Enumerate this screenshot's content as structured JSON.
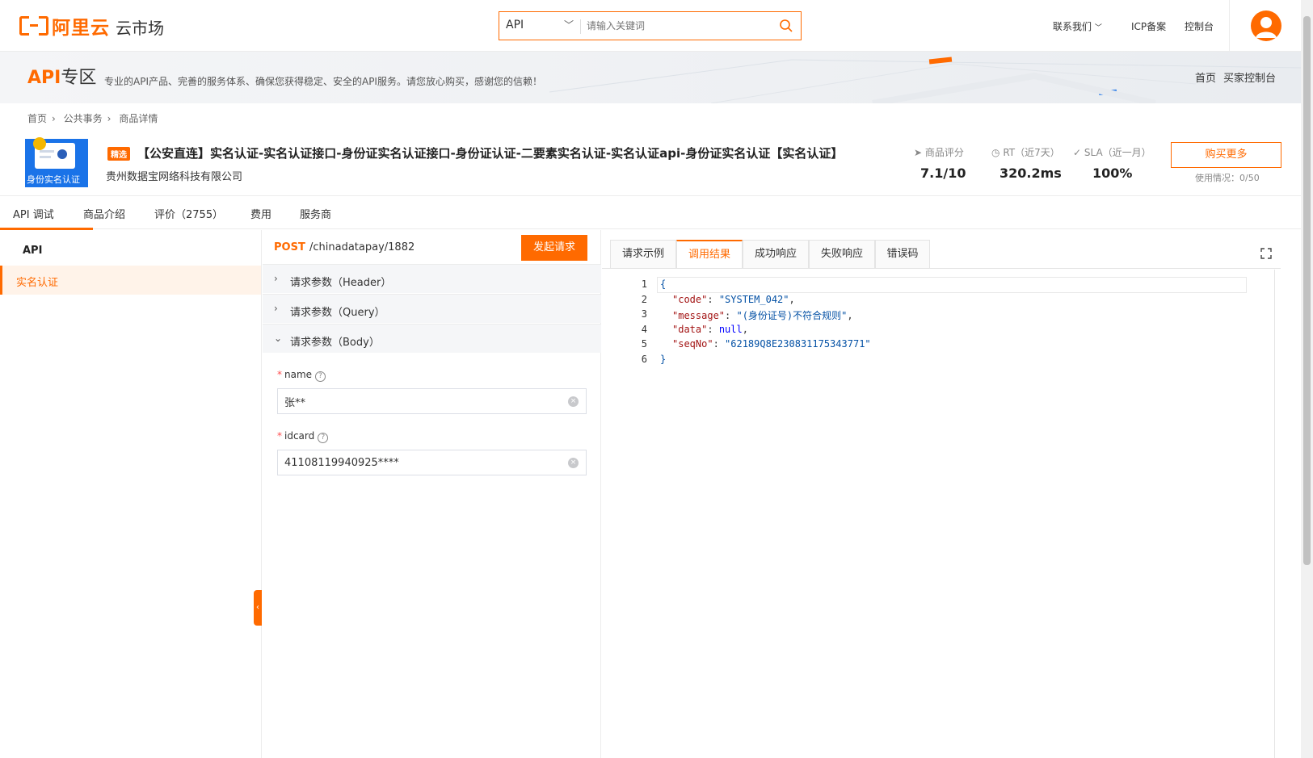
{
  "header": {
    "logo_text": "阿里云",
    "logo_sub": "云市场",
    "search_type": "API",
    "search_placeholder": "请输入关键词",
    "links": [
      "联系我们",
      "ICP备案",
      "控制台"
    ]
  },
  "banner": {
    "title_api": "API",
    "title_zone": "专区",
    "desc": "专业的API产品、完善的服务体系、确保您获得稳定、安全的API服务。请您放心购买，感谢您的信赖！",
    "links": [
      "首页",
      "买家控制台"
    ]
  },
  "breadcrumb": [
    "首页",
    "公共事务",
    "商品详情"
  ],
  "product": {
    "image_caption": "身份实名认证",
    "badge": "精选",
    "title": "【公安直连】实名认证-实名认证接口-身份证实名认证接口-身份证认证-二要素实名认证-实名认证api-身份证实名认证【实名认证】",
    "vendor": "贵州数据宝网络科技有限公司",
    "metrics": [
      {
        "label": "商品评分",
        "value": "7.1/10"
      },
      {
        "label": "RT（近7天）",
        "value": "320.2ms"
      },
      {
        "label": "SLA（近一月）",
        "value": "100%"
      }
    ],
    "buy_label": "购买更多",
    "usage": "使用情况：0/50"
  },
  "tabs": [
    "API 调试",
    "商品介绍",
    "评价（2755）",
    "费用",
    "服务商"
  ],
  "sidebar": {
    "heading": "API",
    "items": [
      "实名认证"
    ]
  },
  "request": {
    "method": "POST",
    "path": "/chinadatapay/1882",
    "send_label": "发起请求",
    "sections": [
      "请求参数（Header）",
      "请求参数（Query）",
      "请求参数（Body）"
    ],
    "fields": [
      {
        "label": "name",
        "value": "张**"
      },
      {
        "label": "idcard",
        "value": "41108119940925****"
      }
    ]
  },
  "result": {
    "tabs": [
      "请求示例",
      "调用结果",
      "成功响应",
      "失败响应",
      "错误码"
    ],
    "active_tab": "调用结果",
    "lines": [
      {
        "n": "1",
        "text": "{"
      },
      {
        "n": "2",
        "key": "\"code\"",
        "val": "\"SYSTEM_042\"",
        "tail": ","
      },
      {
        "n": "3",
        "key": "\"message\"",
        "val": "\"(身份证号)不符合规则\"",
        "tail": ","
      },
      {
        "n": "4",
        "key": "\"data\"",
        "val": "null",
        "tail": ","
      },
      {
        "n": "5",
        "key": "\"seqNo\"",
        "val": "\"62189Q8E230831175343771\"",
        "tail": ""
      },
      {
        "n": "6",
        "text": "}"
      }
    ]
  },
  "colors": {
    "accent": "#ff6a00",
    "link_blue": "#0451a5"
  }
}
